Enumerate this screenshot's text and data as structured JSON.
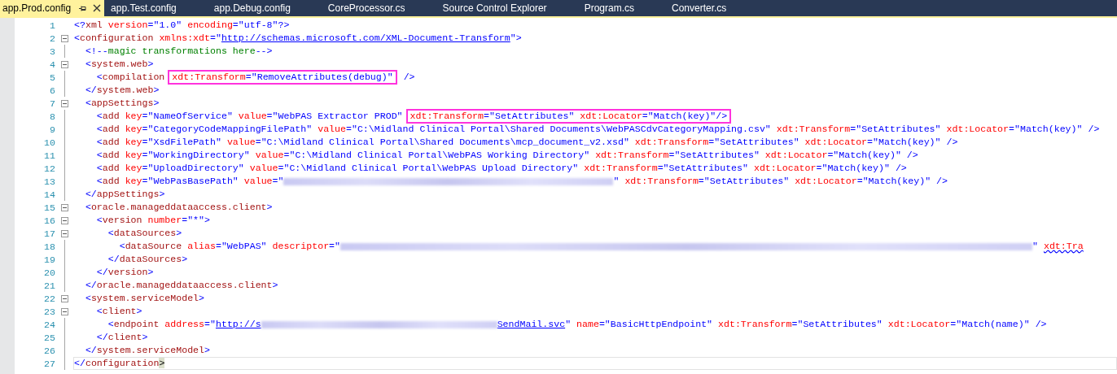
{
  "tabs": [
    {
      "label": "app.Prod.config",
      "selected": true
    },
    {
      "label": "app.Test.config",
      "selected": false
    },
    {
      "label": "app.Debug.config",
      "selected": false
    },
    {
      "label": "CoreProcessor.cs",
      "selected": false
    },
    {
      "label": "Source Control Explorer",
      "selected": false
    },
    {
      "label": "Program.cs",
      "selected": false
    },
    {
      "label": "Converter.cs",
      "selected": false
    }
  ],
  "lines": [
    {
      "number": "1",
      "collapsible": false,
      "current": false,
      "tokens": [
        {
          "kind": "markup",
          "text": "<?"
        },
        {
          "kind": "element",
          "text": "xml"
        },
        {
          "kind": "attr",
          "text": " version"
        },
        {
          "kind": "markup",
          "text": "=\"1.0\""
        },
        {
          "kind": "attr",
          "text": " encoding"
        },
        {
          "kind": "markup",
          "text": "=\"utf-8\"?>"
        }
      ]
    },
    {
      "number": "2",
      "collapsible": true,
      "current": false,
      "tokens": [
        {
          "kind": "markup",
          "text": "<"
        },
        {
          "kind": "element",
          "text": "configuration"
        },
        {
          "kind": "attr",
          "text": " xmlns:xdt"
        },
        {
          "kind": "markup",
          "text": "=\""
        },
        {
          "kind": "link",
          "text": "http://schemas.microsoft.com/XML-Document-Transform"
        },
        {
          "kind": "markup",
          "text": "\">"
        }
      ]
    },
    {
      "number": "3",
      "collapsible": false,
      "current": false,
      "tokens": [
        {
          "kind": "markup",
          "text": "  <!--"
        },
        {
          "kind": "comment",
          "text": "magic transformations here"
        },
        {
          "kind": "markup",
          "text": "-->"
        }
      ]
    },
    {
      "number": "4",
      "collapsible": true,
      "current": false,
      "tokens": [
        {
          "kind": "markup",
          "text": "  <"
        },
        {
          "kind": "element",
          "text": "system.web"
        },
        {
          "kind": "markup",
          "text": ">"
        }
      ]
    },
    {
      "number": "5",
      "collapsible": false,
      "current": false,
      "tokens": [
        {
          "kind": "markup",
          "text": "    <"
        },
        {
          "kind": "element",
          "text": "compilation"
        },
        {
          "kind": "box",
          "tokens": [
            {
              "kind": "attr",
              "text": "xdt:Transform"
            },
            {
              "kind": "markup",
              "text": "=\"RemoveAttributes(debug)\""
            }
          ]
        },
        {
          "kind": "markup",
          "text": " />"
        }
      ]
    },
    {
      "number": "6",
      "collapsible": false,
      "current": false,
      "tokens": [
        {
          "kind": "markup",
          "text": "  </"
        },
        {
          "kind": "element",
          "text": "system.web"
        },
        {
          "kind": "markup",
          "text": ">"
        }
      ]
    },
    {
      "number": "7",
      "collapsible": true,
      "current": false,
      "tokens": [
        {
          "kind": "markup",
          "text": "  <"
        },
        {
          "kind": "element",
          "text": "appSettings"
        },
        {
          "kind": "markup",
          "text": ">"
        }
      ]
    },
    {
      "number": "8",
      "collapsible": false,
      "current": false,
      "tokens": [
        {
          "kind": "markup",
          "text": "    <"
        },
        {
          "kind": "element",
          "text": "add"
        },
        {
          "kind": "attr",
          "text": " key"
        },
        {
          "kind": "markup",
          "text": "=\"NameOfService\""
        },
        {
          "kind": "attr",
          "text": " value"
        },
        {
          "kind": "markup",
          "text": "=\"WebPAS Extractor PROD\""
        },
        {
          "kind": "box",
          "tokens": [
            {
              "kind": "attr",
              "text": "xdt:Transform"
            },
            {
              "kind": "markup",
              "text": "=\"SetAttributes\""
            },
            {
              "kind": "attr",
              "text": " xdt:Locator"
            },
            {
              "kind": "markup",
              "text": "=\"Match(key)\"/>"
            }
          ]
        }
      ]
    },
    {
      "number": "9",
      "collapsible": false,
      "current": false,
      "tokens": [
        {
          "kind": "markup",
          "text": "    <"
        },
        {
          "kind": "element",
          "text": "add"
        },
        {
          "kind": "attr",
          "text": " key"
        },
        {
          "kind": "markup",
          "text": "=\"CategoryCodeMappingFilePath\""
        },
        {
          "kind": "attr",
          "text": " value"
        },
        {
          "kind": "markup",
          "text": "=\"C:\\Midland Clinical Portal\\Shared Documents\\WebPASCdvCategoryMapping.csv\""
        },
        {
          "kind": "attr",
          "text": " xdt:Transform"
        },
        {
          "kind": "markup",
          "text": "=\"SetAttributes\""
        },
        {
          "kind": "attr",
          "text": " xdt:Locator"
        },
        {
          "kind": "markup",
          "text": "=\"Match(key)\" />"
        }
      ]
    },
    {
      "number": "10",
      "collapsible": false,
      "current": false,
      "tokens": [
        {
          "kind": "markup",
          "text": "    <"
        },
        {
          "kind": "element",
          "text": "add"
        },
        {
          "kind": "attr",
          "text": " key"
        },
        {
          "kind": "markup",
          "text": "=\"XsdFilePath\""
        },
        {
          "kind": "attr",
          "text": " value"
        },
        {
          "kind": "markup",
          "text": "=\"C:\\Midland Clinical Portal\\Shared Documents\\mcp_document_v2.xsd\""
        },
        {
          "kind": "attr",
          "text": " xdt:Transform"
        },
        {
          "kind": "markup",
          "text": "=\"SetAttributes\""
        },
        {
          "kind": "attr",
          "text": " xdt:Locator"
        },
        {
          "kind": "markup",
          "text": "=\"Match(key)\" />"
        }
      ]
    },
    {
      "number": "11",
      "collapsible": false,
      "current": false,
      "tokens": [
        {
          "kind": "markup",
          "text": "    <"
        },
        {
          "kind": "element",
          "text": "add"
        },
        {
          "kind": "attr",
          "text": " key"
        },
        {
          "kind": "markup",
          "text": "=\"WorkingDirectory\""
        },
        {
          "kind": "attr",
          "text": " value"
        },
        {
          "kind": "markup",
          "text": "=\"C:\\Midland Clinical Portal\\WebPAS Working Directory\""
        },
        {
          "kind": "attr",
          "text": " xdt:Transform"
        },
        {
          "kind": "markup",
          "text": "=\"SetAttributes\""
        },
        {
          "kind": "attr",
          "text": " xdt:Locator"
        },
        {
          "kind": "markup",
          "text": "=\"Match(key)\" />"
        }
      ]
    },
    {
      "number": "12",
      "collapsible": false,
      "current": false,
      "tokens": [
        {
          "kind": "markup",
          "text": "    <"
        },
        {
          "kind": "element",
          "text": "add"
        },
        {
          "kind": "attr",
          "text": " key"
        },
        {
          "kind": "markup",
          "text": "=\"UploadDirectory\""
        },
        {
          "kind": "attr",
          "text": " value"
        },
        {
          "kind": "markup",
          "text": "=\"C:\\Midland Clinical Portal\\WebPAS Upload Directory\""
        },
        {
          "kind": "attr",
          "text": " xdt:Transform"
        },
        {
          "kind": "markup",
          "text": "=\"SetAttributes\""
        },
        {
          "kind": "attr",
          "text": " xdt:Locator"
        },
        {
          "kind": "markup",
          "text": "=\"Match(key)\" />"
        }
      ]
    },
    {
      "number": "13",
      "collapsible": false,
      "current": false,
      "tokens": [
        {
          "kind": "markup",
          "text": "    <"
        },
        {
          "kind": "element",
          "text": "add"
        },
        {
          "kind": "attr",
          "text": " key"
        },
        {
          "kind": "markup",
          "text": "=\"WebPasBasePath\""
        },
        {
          "kind": "attr",
          "text": " value"
        },
        {
          "kind": "markup",
          "text": "=\""
        },
        {
          "kind": "redacted-medium"
        },
        {
          "kind": "markup",
          "text": "\""
        },
        {
          "kind": "attr",
          "text": " xdt:Transform"
        },
        {
          "kind": "markup",
          "text": "=\"SetAttributes\""
        },
        {
          "kind": "attr",
          "text": " xdt:Locator"
        },
        {
          "kind": "markup",
          "text": "=\"Match(key)\" />"
        }
      ]
    },
    {
      "number": "14",
      "collapsible": false,
      "current": false,
      "tokens": [
        {
          "kind": "markup",
          "text": "  </"
        },
        {
          "kind": "element",
          "text": "appSettings"
        },
        {
          "kind": "markup",
          "text": ">"
        }
      ]
    },
    {
      "number": "15",
      "collapsible": true,
      "current": false,
      "tokens": [
        {
          "kind": "markup",
          "text": "  <"
        },
        {
          "kind": "element",
          "text": "oracle.manageddataaccess.client"
        },
        {
          "kind": "markup",
          "text": ">"
        }
      ]
    },
    {
      "number": "16",
      "collapsible": true,
      "current": false,
      "tokens": [
        {
          "kind": "markup",
          "text": "    <"
        },
        {
          "kind": "element",
          "text": "version"
        },
        {
          "kind": "attr",
          "text": " number"
        },
        {
          "kind": "markup",
          "text": "=\"*\">"
        }
      ]
    },
    {
      "number": "17",
      "collapsible": true,
      "current": false,
      "tokens": [
        {
          "kind": "markup",
          "text": "      <"
        },
        {
          "kind": "element",
          "text": "dataSources"
        },
        {
          "kind": "markup",
          "text": ">"
        }
      ]
    },
    {
      "number": "18",
      "collapsible": false,
      "current": false,
      "tokens": [
        {
          "kind": "markup",
          "text": "        <"
        },
        {
          "kind": "element",
          "text": "dataSource"
        },
        {
          "kind": "attr",
          "text": " alias"
        },
        {
          "kind": "markup",
          "text": "=\"WebPAS\""
        },
        {
          "kind": "attr",
          "text": " descriptor"
        },
        {
          "kind": "markup",
          "text": "=\""
        },
        {
          "kind": "redacted-long"
        },
        {
          "kind": "markup",
          "text": "\" "
        },
        {
          "kind": "error",
          "text": "xdt:Tra"
        }
      ]
    },
    {
      "number": "19",
      "collapsible": false,
      "current": false,
      "tokens": [
        {
          "kind": "markup",
          "text": "      </"
        },
        {
          "kind": "element",
          "text": "dataSources"
        },
        {
          "kind": "markup",
          "text": ">"
        }
      ]
    },
    {
      "number": "20",
      "collapsible": false,
      "current": false,
      "tokens": [
        {
          "kind": "markup",
          "text": "    </"
        },
        {
          "kind": "element",
          "text": "version"
        },
        {
          "kind": "markup",
          "text": ">"
        }
      ]
    },
    {
      "number": "21",
      "collapsible": false,
      "current": false,
      "tokens": [
        {
          "kind": "markup",
          "text": "  </"
        },
        {
          "kind": "element",
          "text": "oracle.manageddataaccess.client"
        },
        {
          "kind": "markup",
          "text": ">"
        }
      ]
    },
    {
      "number": "22",
      "collapsible": true,
      "current": false,
      "tokens": [
        {
          "kind": "markup",
          "text": "  <"
        },
        {
          "kind": "element",
          "text": "system.serviceModel"
        },
        {
          "kind": "markup",
          "text": ">"
        }
      ]
    },
    {
      "number": "23",
      "collapsible": true,
      "current": false,
      "tokens": [
        {
          "kind": "markup",
          "text": "    <"
        },
        {
          "kind": "element",
          "text": "client"
        },
        {
          "kind": "markup",
          "text": ">"
        }
      ]
    },
    {
      "number": "24",
      "collapsible": false,
      "current": false,
      "tokens": [
        {
          "kind": "markup",
          "text": "      <"
        },
        {
          "kind": "element",
          "text": "endpoint"
        },
        {
          "kind": "attr",
          "text": " address"
        },
        {
          "kind": "markup",
          "text": "=\""
        },
        {
          "kind": "link",
          "text": "http://s"
        },
        {
          "kind": "redacted-short"
        },
        {
          "kind": "link",
          "text": "SendMail.svc"
        },
        {
          "kind": "markup",
          "text": "\""
        },
        {
          "kind": "attr",
          "text": " name"
        },
        {
          "kind": "markup",
          "text": "=\"BasicHttpEndpoint\""
        },
        {
          "kind": "attr",
          "text": " xdt:Transform"
        },
        {
          "kind": "markup",
          "text": "=\"SetAttributes\""
        },
        {
          "kind": "attr",
          "text": " xdt:Locator"
        },
        {
          "kind": "markup",
          "text": "=\"Match(name)\" />"
        }
      ]
    },
    {
      "number": "25",
      "collapsible": false,
      "current": false,
      "tokens": [
        {
          "kind": "markup",
          "text": "    </"
        },
        {
          "kind": "element",
          "text": "client"
        },
        {
          "kind": "markup",
          "text": ">"
        }
      ]
    },
    {
      "number": "26",
      "collapsible": false,
      "current": false,
      "tokens": [
        {
          "kind": "markup",
          "text": "  </"
        },
        {
          "kind": "element",
          "text": "system.serviceModel"
        },
        {
          "kind": "markup",
          "text": ">"
        }
      ]
    },
    {
      "number": "27",
      "collapsible": false,
      "current": true,
      "tokens": [
        {
          "kind": "markup",
          "text": "</"
        },
        {
          "kind": "element",
          "text": "configuration"
        },
        {
          "kind": "match",
          "text": ">"
        }
      ]
    }
  ]
}
